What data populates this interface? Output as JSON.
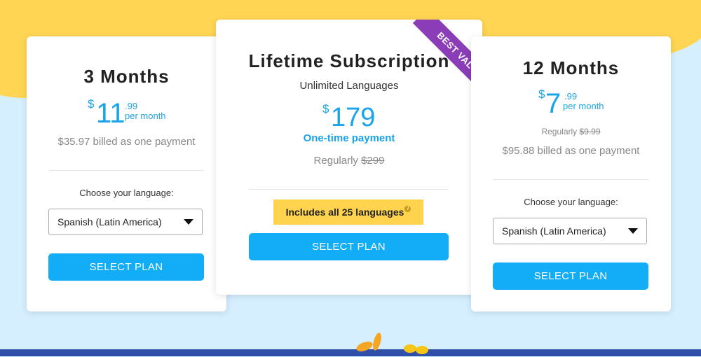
{
  "plans": {
    "three_months": {
      "title": "3 Months",
      "currency": "$",
      "price_whole": "11",
      "price_cents": ".99",
      "per": "per month",
      "billed": "$35.97 billed as one payment",
      "choose_label": "Choose your language:",
      "language_selected": "Spanish (Latin America)",
      "button": "SELECT PLAN"
    },
    "lifetime": {
      "title": "Lifetime Subscription",
      "subtitle": "Unlimited Languages",
      "currency": "$",
      "price": "179",
      "onetime": "One-time payment",
      "regular_prefix": "Regularly ",
      "regular_price": "$299",
      "includes": "Includes all 25 languages",
      "info_glyph": "i",
      "ribbon": "BEST VALUE",
      "button": "SELECT PLAN"
    },
    "twelve_months": {
      "title": "12 Months",
      "currency": "$",
      "price_whole": "7",
      "price_cents": ".99",
      "per": "per month",
      "regular_prefix": "Regularly ",
      "regular_price": "$9.99",
      "billed": "$95.88 billed as one payment",
      "choose_label": "Choose your language:",
      "language_selected": "Spanish (Latin America)",
      "button": "SELECT PLAN"
    }
  },
  "colors": {
    "accent": "#13adf7",
    "price_blue": "#1aa3e8",
    "ribbon": "#8a3db6",
    "highlight": "#ffd34d",
    "background_blue": "#d6efff",
    "background_yellow": "#ffd553"
  }
}
